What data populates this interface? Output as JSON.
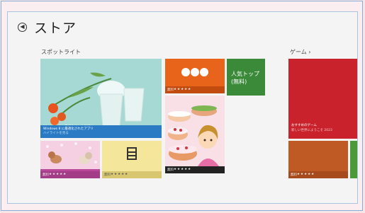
{
  "header": {
    "title": "ストア"
  },
  "sections": {
    "spotlight": "スポットライト",
    "games": "ゲーム ›"
  },
  "tiles": {
    "spotlight_main": {
      "caption_line1": "Windows 8 に最適化されたアプリ",
      "caption_line2": "ハイライトを見る"
    },
    "top_popular": {
      "label_line1": "人気トップ",
      "label_line2": "(無料)"
    },
    "free_label": "無料",
    "stars": "★★★★★",
    "game_feature": {
      "caption_line1": "おすすめのゲーム",
      "caption_line2": "新しい世界にようこそ 2023"
    }
  },
  "colors": {
    "orange": "#e8641a",
    "green": "#3a8a3a",
    "red": "#c9222c",
    "blue": "#2b7bc4",
    "purple": "#b9479a",
    "teal": "#a2d6d0",
    "yellow": "#f4e79b",
    "pink": "#f8d6e6"
  }
}
